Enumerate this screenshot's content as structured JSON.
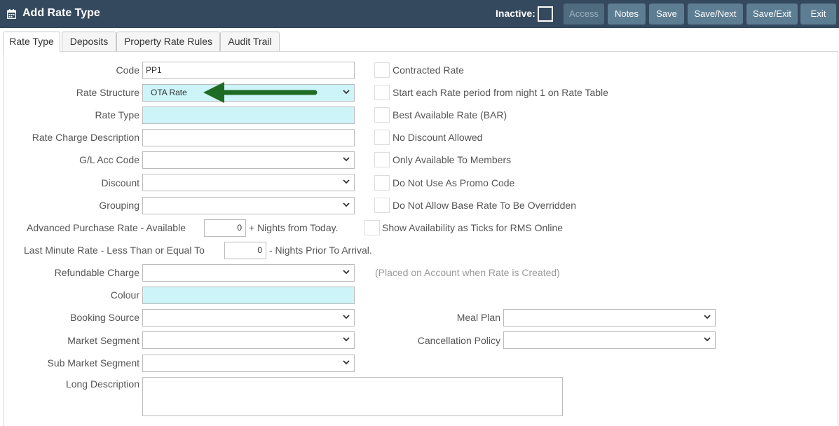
{
  "header": {
    "title": "Add Rate Type",
    "inactive_label": "Inactive:",
    "buttons": {
      "access": "Access",
      "notes": "Notes",
      "save": "Save",
      "save_next": "Save/Next",
      "save_exit": "Save/Exit",
      "exit": "Exit"
    }
  },
  "tabs": [
    "Rate Type",
    "Deposits",
    "Property Rate Rules",
    "Audit Trail"
  ],
  "form": {
    "code": {
      "label": "Code",
      "value": "PP1"
    },
    "rate_structure": {
      "label": "Rate Structure",
      "value": "OTA Rate"
    },
    "rate_type": {
      "label": "Rate Type",
      "value": ""
    },
    "rate_charge_description": {
      "label": "Rate Charge Description",
      "value": ""
    },
    "gl_acc_code": {
      "label": "G/L Acc Code",
      "value": ""
    },
    "discount": {
      "label": "Discount",
      "value": ""
    },
    "grouping": {
      "label": "Grouping",
      "value": ""
    },
    "advanced_purchase": {
      "label": "Advanced Purchase Rate - Available",
      "value": "0",
      "suffix": "+ Nights from Today."
    },
    "last_minute": {
      "label": "Last Minute Rate - Less Than or Equal To",
      "value": "0",
      "suffix": "- Nights Prior To Arrival."
    },
    "refundable_charge": {
      "label": "Refundable Charge",
      "value": "",
      "note": "(Placed on Account when Rate is Created)"
    },
    "colour": {
      "label": "Colour",
      "value": ""
    },
    "booking_source": {
      "label": "Booking Source",
      "value": ""
    },
    "market_segment": {
      "label": "Market Segment",
      "value": ""
    },
    "sub_market_segment": {
      "label": "Sub Market Segment",
      "value": ""
    },
    "long_description": {
      "label": "Long Description",
      "value": ""
    },
    "meal_plan": {
      "label": "Meal Plan",
      "value": ""
    },
    "cancellation_policy": {
      "label": "Cancellation Policy",
      "value": ""
    }
  },
  "checkboxes": [
    "Contracted Rate",
    "Start each Rate period from night 1 on Rate Table",
    "Best Available Rate (BAR)",
    "No Discount Allowed",
    "Only Available To Members",
    "Do Not Use As Promo Code",
    "Do Not Allow Base Rate To Be Overridden",
    "Show Availability as Ticks for RMS Online"
  ],
  "colors": {
    "header_bg": "#34495e",
    "button_bg": "#5d7d92",
    "highlight_field": "#cdf5f9",
    "arrow": "#1e6b24"
  },
  "icons": {
    "header": "calendar-icon",
    "select": "chevron-down-icon",
    "annotation": "green-arrow-icon"
  }
}
